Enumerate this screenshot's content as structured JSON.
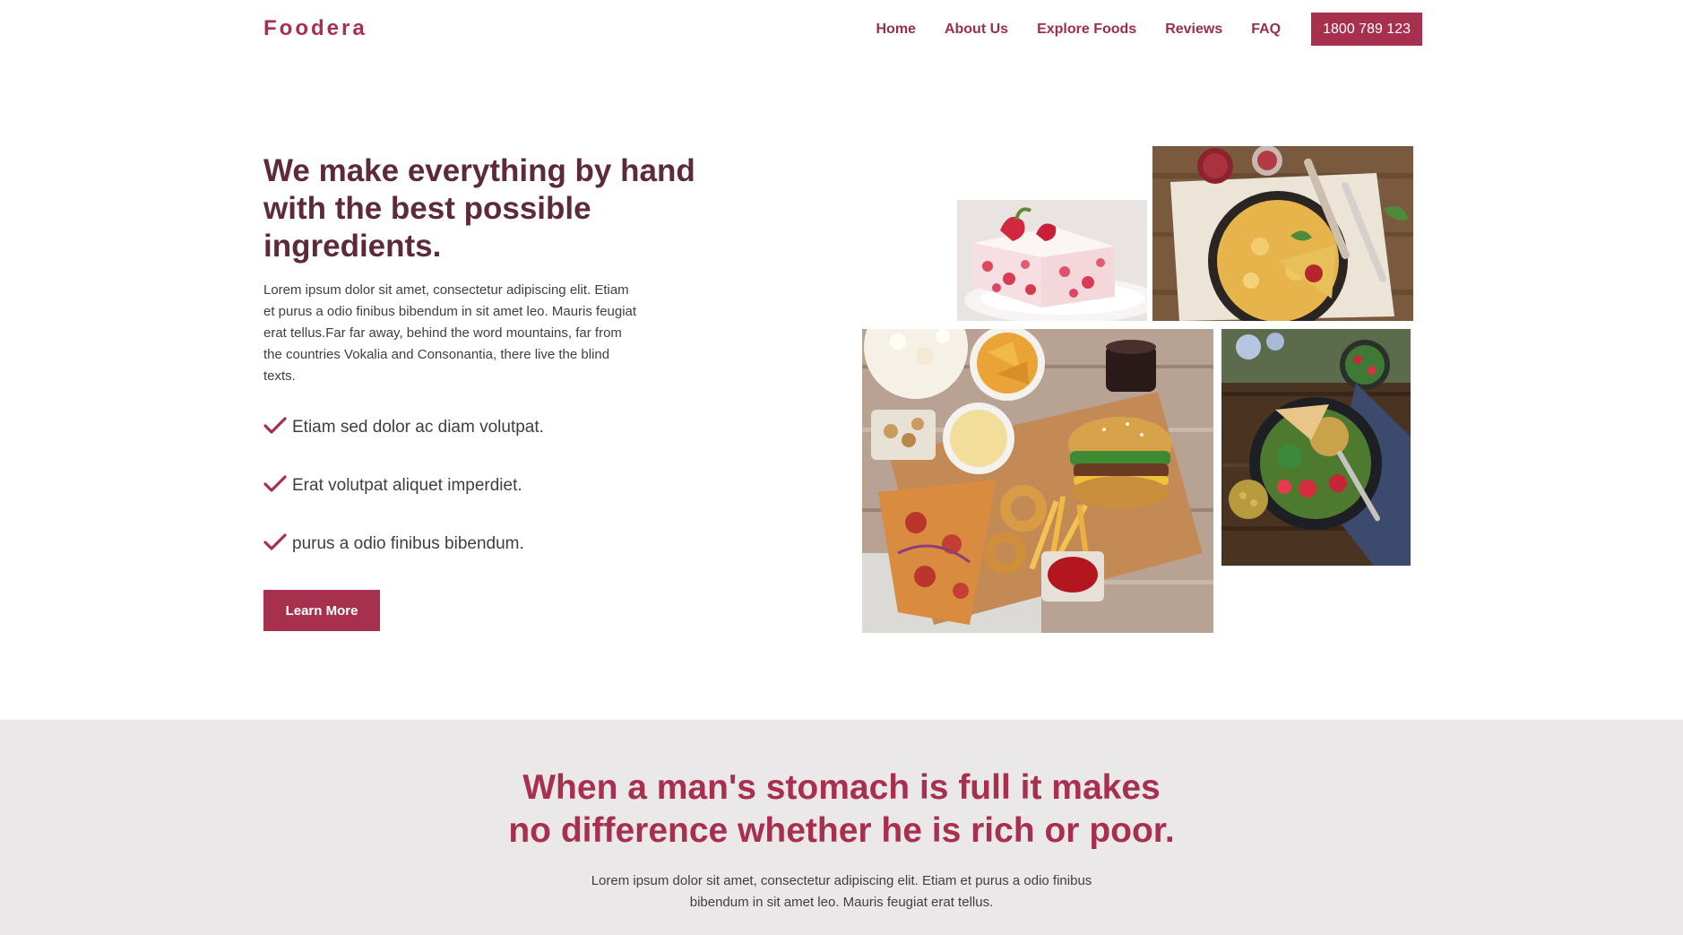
{
  "brand": {
    "name": "Foodera"
  },
  "nav": {
    "items": [
      {
        "label": "Home"
      },
      {
        "label": "About Us"
      },
      {
        "label": "Explore Foods"
      },
      {
        "label": "Reviews"
      },
      {
        "label": "FAQ"
      }
    ],
    "phone": "1800 789 123"
  },
  "hero": {
    "title": "We make everything by hand with the best possible ingredients.",
    "description": "Lorem ipsum dolor sit amet, consectetur adipiscing elit. Etiam et purus a odio finibus bibendum in sit amet leo. Mauris feugiat erat tellus.Far far away, behind the word mountains, far from the countries Vokalia and Consonantia, there live the blind texts.",
    "features": [
      {
        "text": "Etiam sed dolor ac diam volutpat.",
        "icon": "check-icon"
      },
      {
        "text": "Erat volutpat aliquet imperdiet.",
        "icon": "check-icon"
      },
      {
        "text": "purus a odio finibus bibendum.",
        "icon": "check-icon"
      }
    ],
    "cta_label": "Learn More"
  },
  "gallery": {
    "images": [
      "cake-slice-image",
      "quiche-image",
      "fast-food-platter-image",
      "salad-bowl-image"
    ]
  },
  "quote": {
    "title": "When a man's stomach is full it makes no difference whether he is rich or poor.",
    "description": "Lorem ipsum dolor sit amet, consectetur adipiscing elit. Etiam et purus a odio finibus bibendum in sit amet leo. Mauris feugiat erat tellus."
  },
  "colors": {
    "accent": "#a8304f",
    "heading": "#5d2a3b",
    "band_background": "#ebe8ea"
  }
}
